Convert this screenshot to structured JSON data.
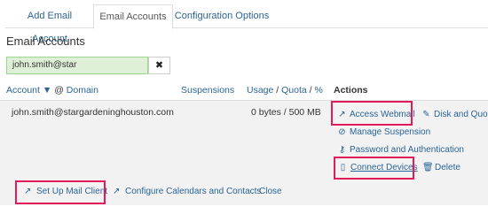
{
  "tabs": [
    {
      "label": "Add Email Account",
      "active": false
    },
    {
      "label": "Email Accounts",
      "active": true
    },
    {
      "label": "Configuration Options",
      "active": false
    }
  ],
  "section_title": "Email Accounts",
  "search": {
    "value": "john.smith@star",
    "clear_icon": "✖"
  },
  "columns": {
    "account": "Account",
    "sort_icon": "▼",
    "at": "@",
    "domain": "Domain",
    "suspensions": "Suspensions",
    "usage": "Usage",
    "slash1": "/",
    "quota": "Quota",
    "slash2": "/",
    "percent": "%",
    "actions": "Actions"
  },
  "row": {
    "account": "john.smith@stargardeninghouston.com",
    "usage": "0 bytes / 500 MB"
  },
  "actions": {
    "access_webmail": "Access Webmail",
    "disk_quota": "Disk and Quota",
    "manage_suspension": "Manage Suspension",
    "password_auth": "Password and Authentication",
    "connect_devices": "Connect Devices",
    "delete": "Delete"
  },
  "bottom": {
    "setup_mail_client": "Set Up Mail Client",
    "configure_calendars": "Configure Calendars and Contacts",
    "close": "Close"
  },
  "colors": {
    "link": "#2a6496",
    "highlight": "#e31b5a",
    "search_bg": "#dff0d8"
  }
}
